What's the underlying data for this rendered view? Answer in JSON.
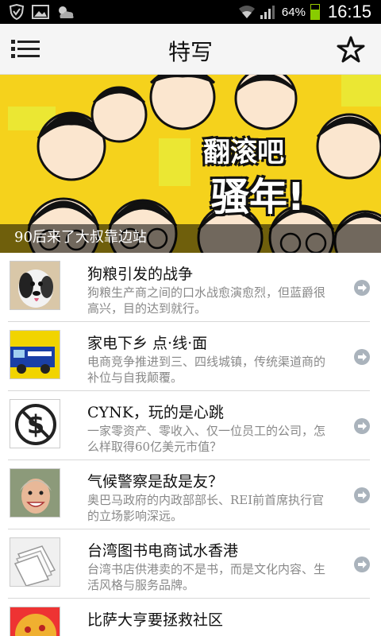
{
  "status_bar": {
    "battery_percent": "64%",
    "time": "16:15"
  },
  "header": {
    "title": "特写"
  },
  "banner": {
    "caption": "90后来了大叔靠边站",
    "headline_line1": "翻滚吧",
    "headline_line2": "骚年!"
  },
  "articles": [
    {
      "title": "狗粮引发的战争",
      "desc": "狗粮生产商之间的口水战愈演愈烈，但蓝爵很高兴，目的达到就行。",
      "thumb": "dog-photo"
    },
    {
      "title": "家电下乡 点·线·面",
      "desc": "电商竞争推进到三、四线城镇，传统渠道商的补位与自我颠覆。",
      "thumb": "delivery-van-photo"
    },
    {
      "title": "CYNK，玩的是心跳",
      "desc": "一家零资产、零收入、仅一位员工的公司，怎么样取得60亿美元市值？",
      "thumb": "no-dollar-sign"
    },
    {
      "title": "气候警察是敌是友？",
      "desc": "奥巴马政府的内政部部长、REI前首席执行官的立场影响深远。",
      "thumb": "woman-portrait"
    },
    {
      "title": "台湾图书电商试水香港",
      "desc": "台湾书店供港卖的不是书，而是文化内容、生活风格与服务品牌。",
      "thumb": "paper-stack"
    },
    {
      "title": "比萨大亨要拯救社区",
      "desc": "",
      "thumb": "pizza-photo"
    }
  ]
}
